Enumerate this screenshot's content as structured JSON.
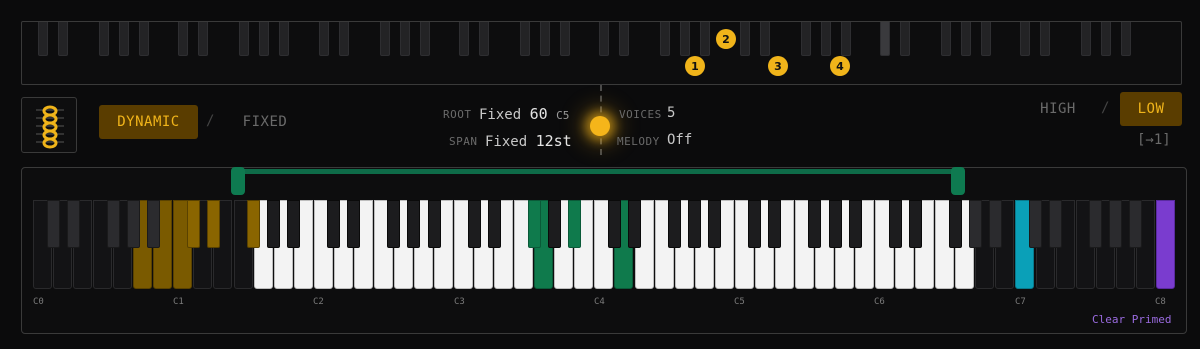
{
  "colors": {
    "accent": "#f0b41a",
    "range": "#0e6b48",
    "marked_green": "#0f7a4c",
    "marked_cyan": "#0aa0b8",
    "marked_purple": "#7a3ccf",
    "marked_gold": "#7a5a00"
  },
  "mini_keyboard": {
    "badges": [
      "1",
      "2",
      "3",
      "4"
    ]
  },
  "logo": {
    "icon": "chord-stack-icon"
  },
  "mode": {
    "dynamic": "DYNAMIC",
    "separator": "/",
    "fixed": "FIXED",
    "selected": "DYNAMIC"
  },
  "root": {
    "label": "ROOT",
    "mode": "Fixed",
    "value": "60",
    "note": "C5"
  },
  "span": {
    "label": "SPAN",
    "mode": "Fixed",
    "value": "12st"
  },
  "voices": {
    "label": "VOICES",
    "value": "5"
  },
  "melody": {
    "label": "MELODY",
    "value": "Off"
  },
  "voicing": {
    "high": "HIGH",
    "separator": "/",
    "low": "LOW",
    "selected": "LOW"
  },
  "arrow_readout": "[→1]",
  "keyboard": {
    "octave_labels": [
      "C0",
      "C1",
      "C2",
      "C3",
      "C4",
      "C5",
      "C6",
      "C7",
      "C8"
    ],
    "clear_primed": "Clear Primed"
  }
}
